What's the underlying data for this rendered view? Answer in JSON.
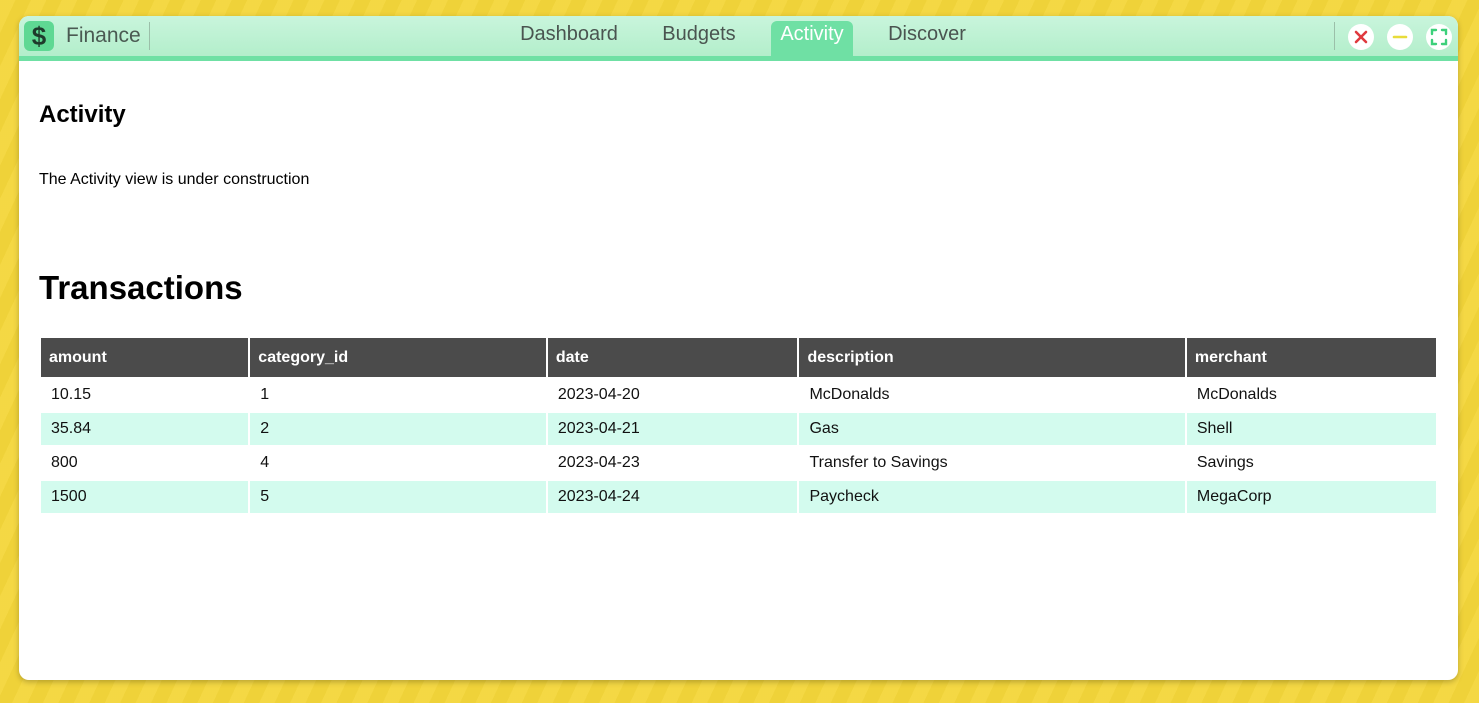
{
  "app": {
    "name": "Finance",
    "icon": "dollar-icon",
    "accent_color": "#6fe0a4"
  },
  "nav": {
    "tabs": [
      {
        "label": "Dashboard",
        "active": false
      },
      {
        "label": "Budgets",
        "active": false
      },
      {
        "label": "Activity",
        "active": true
      },
      {
        "label": "Discover",
        "active": false
      }
    ]
  },
  "window_controls": {
    "close": "close-icon",
    "minimize": "minimize-icon",
    "maximize": "maximize-icon"
  },
  "main": {
    "section_title": "Activity",
    "message": "The Activity view is under construction",
    "transactions_title": "Transactions",
    "table": {
      "columns": [
        "amount",
        "category_id",
        "date",
        "description",
        "merchant"
      ],
      "rows": [
        [
          "10.15",
          "1",
          "2023-04-20",
          "McDonalds",
          "McDonalds"
        ],
        [
          "35.84",
          "2",
          "2023-04-21",
          "Gas",
          "Shell"
        ],
        [
          "800",
          "4",
          "2023-04-23",
          "Transfer to Savings",
          "Savings"
        ],
        [
          "1500",
          "5",
          "2023-04-24",
          "Paycheck",
          "MegaCorp"
        ]
      ]
    }
  }
}
